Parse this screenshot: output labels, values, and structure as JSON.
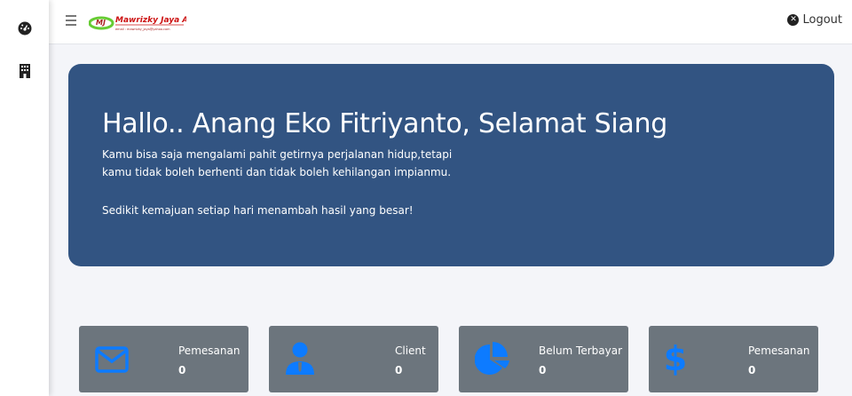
{
  "logo": {
    "name": "Mawrizky Jaya Adv.",
    "email": "email : mawrizky_jaya@yahoo.com"
  },
  "topbar": {
    "logout_label": "Logout"
  },
  "banner": {
    "greeting": "Hallo.. Anang Eko Fitriyanto, Selamat Siang",
    "quote": "Kamu bisa saja mengalami pahit getirnya perjalanan hidup,tetapi kamu tidak boleh berhenti dan tidak boleh kehilangan impianmu.",
    "motto": "Sedikit kemajuan setiap hari menambah hasil yang besar!"
  },
  "cards": [
    {
      "icon": "envelope-icon",
      "label": "Pemesanan",
      "value": "0"
    },
    {
      "icon": "user-tie-icon",
      "label": "Client",
      "value": "0"
    },
    {
      "icon": "pie-chart-icon",
      "label": "Belum Terbayar",
      "value": "0"
    },
    {
      "icon": "dollar-icon",
      "label": "Pemesanan",
      "value": "0"
    }
  ],
  "colors": {
    "banner": "#325482",
    "card": "#6c757d",
    "icon": "#0d7bff"
  }
}
